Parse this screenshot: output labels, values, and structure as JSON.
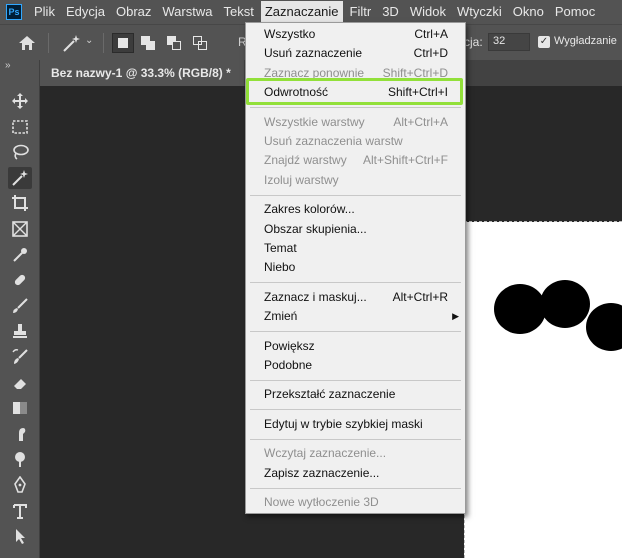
{
  "app": {
    "logo": "Ps"
  },
  "menubar": {
    "items": [
      "Plik",
      "Edycja",
      "Obraz",
      "Warstwa",
      "Tekst",
      "Zaznaczanie",
      "Filtr",
      "3D",
      "Widok",
      "Wtyczki",
      "Okno",
      "Pomoc"
    ],
    "active_index": 5
  },
  "options": {
    "label_fragment": "R",
    "tolerance_label": "cja:",
    "tolerance_value": "32",
    "antialias_label": "Wygładzanie",
    "antialias_checked": true
  },
  "tabs": {
    "doc_title": "Bez nazwy-1 @ 33.3% (RGB/8) *",
    "close_glyph": "×"
  },
  "toolbar": {
    "collapse_glyph": "»",
    "tools": [
      "move-tool",
      "marquee-tool",
      "lasso-tool",
      "magic-wand-tool",
      "crop-tool",
      "frame-tool",
      "eyedropper-tool",
      "healing-brush-tool",
      "brush-tool",
      "clone-stamp-tool",
      "history-brush-tool",
      "eraser-tool",
      "gradient-tool",
      "smudge-tool",
      "dodge-tool",
      "pen-tool",
      "type-tool",
      "path-selection-tool"
    ],
    "active_tool": "magic-wand-tool"
  },
  "dropdown": {
    "groups": [
      [
        {
          "label": "Wszystko",
          "shortcut": "Ctrl+A",
          "enabled": true
        },
        {
          "label": "Usuń zaznaczenie",
          "shortcut": "Ctrl+D",
          "enabled": true
        },
        {
          "label": "Zaznacz ponownie",
          "shortcut": "Shift+Ctrl+D",
          "enabled": false
        },
        {
          "label": "Odwrotność",
          "shortcut": "Shift+Ctrl+I",
          "enabled": true,
          "highlighted": true
        }
      ],
      [
        {
          "label": "Wszystkie warstwy",
          "shortcut": "Alt+Ctrl+A",
          "enabled": false
        },
        {
          "label": "Usuń zaznaczenia warstw",
          "shortcut": "",
          "enabled": false
        },
        {
          "label": "Znajdź warstwy",
          "shortcut": "Alt+Shift+Ctrl+F",
          "enabled": false
        },
        {
          "label": "Izoluj warstwy",
          "shortcut": "",
          "enabled": false
        }
      ],
      [
        {
          "label": "Zakres kolorów...",
          "shortcut": "",
          "enabled": true
        },
        {
          "label": "Obszar skupienia...",
          "shortcut": "",
          "enabled": true
        },
        {
          "label": "Temat",
          "shortcut": "",
          "enabled": true
        },
        {
          "label": "Niebo",
          "shortcut": "",
          "enabled": true
        }
      ],
      [
        {
          "label": "Zaznacz i maskuj...",
          "shortcut": "Alt+Ctrl+R",
          "enabled": true
        },
        {
          "label": "Zmień",
          "shortcut": "",
          "enabled": true,
          "submenu": true
        }
      ],
      [
        {
          "label": "Powiększ",
          "shortcut": "",
          "enabled": true
        },
        {
          "label": "Podobne",
          "shortcut": "",
          "enabled": true
        }
      ],
      [
        {
          "label": "Przekształć zaznaczenie",
          "shortcut": "",
          "enabled": true
        }
      ],
      [
        {
          "label": "Edytuj w trybie szybkiej maski",
          "shortcut": "",
          "enabled": true
        }
      ],
      [
        {
          "label": "Wczytaj zaznaczenie...",
          "shortcut": "",
          "enabled": false
        },
        {
          "label": "Zapisz zaznaczenie...",
          "shortcut": "",
          "enabled": true
        }
      ],
      [
        {
          "label": "Nowe wytłoczenie 3D",
          "shortcut": "",
          "enabled": false
        }
      ]
    ]
  },
  "colors": {
    "highlight_border": "#92e03a",
    "ui_panel": "#535353",
    "workspace": "#282828"
  }
}
